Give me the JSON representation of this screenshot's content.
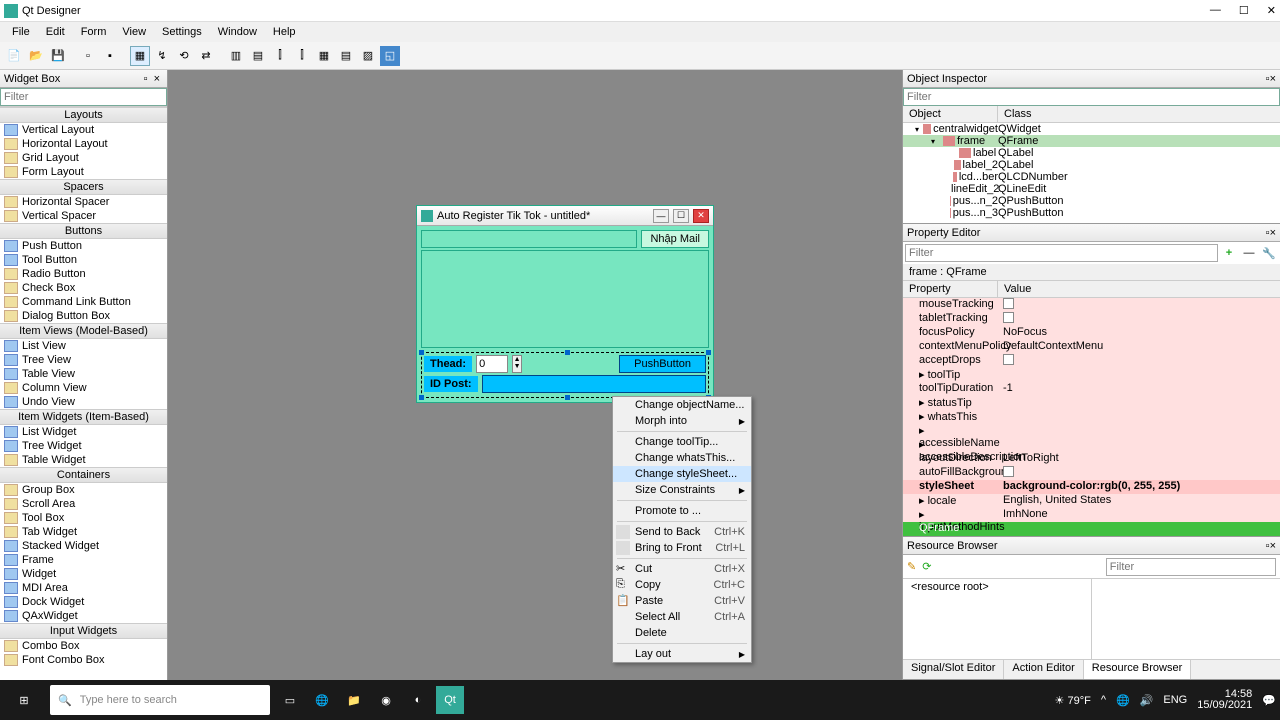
{
  "app": {
    "title": "Qt Designer"
  },
  "menus": [
    "File",
    "Edit",
    "Form",
    "View",
    "Settings",
    "Window",
    "Help"
  ],
  "widgetbox": {
    "title": "Widget Box",
    "filter_placeholder": "Filter",
    "groups": [
      {
        "header": "Layouts",
        "items": [
          "Vertical Layout",
          "Horizontal Layout",
          "Grid Layout",
          "Form Layout"
        ]
      },
      {
        "header": "Spacers",
        "items": [
          "Horizontal Spacer",
          "Vertical Spacer"
        ]
      },
      {
        "header": "Buttons",
        "items": [
          "Push Button",
          "Tool Button",
          "Radio Button",
          "Check Box",
          "Command Link Button",
          "Dialog Button Box"
        ]
      },
      {
        "header": "Item Views (Model-Based)",
        "items": [
          "List View",
          "Tree View",
          "Table View",
          "Column View",
          "Undo View"
        ]
      },
      {
        "header": "Item Widgets (Item-Based)",
        "items": [
          "List Widget",
          "Tree Widget",
          "Table Widget"
        ]
      },
      {
        "header": "Containers",
        "items": [
          "Group Box",
          "Scroll Area",
          "Tool Box",
          "Tab Widget",
          "Stacked Widget",
          "Frame",
          "Widget",
          "MDI Area",
          "Dock Widget",
          "QAxWidget"
        ]
      },
      {
        "header": "Input Widgets",
        "items": [
          "Combo Box",
          "Font Combo Box"
        ]
      }
    ]
  },
  "form": {
    "title": "Auto Register Tik Tok - untitled*",
    "nhapmail": "Nhập Mail",
    "thead_label": "Thead:",
    "thead_value": "0",
    "pushbutton": "PushButton",
    "idpost_label": "ID Post:"
  },
  "context_menu": {
    "change_objectname": "Change objectName...",
    "morph": "Morph into",
    "change_tooltip": "Change toolTip...",
    "change_whatsthis": "Change whatsThis...",
    "change_stylesheet": "Change styleSheet...",
    "size_constraints": "Size Constraints",
    "promote": "Promote to ...",
    "send_back": "Send to Back",
    "send_back_key": "Ctrl+K",
    "bring_front": "Bring to Front",
    "bring_front_key": "Ctrl+L",
    "cut": "Cut",
    "cut_key": "Ctrl+X",
    "copy": "Copy",
    "copy_key": "Ctrl+C",
    "paste": "Paste",
    "paste_key": "Ctrl+V",
    "select_all": "Select All",
    "select_all_key": "Ctrl+A",
    "delete": "Delete",
    "layout": "Lay out"
  },
  "object_inspector": {
    "title": "Object Inspector",
    "filter_placeholder": "Filter",
    "cols": {
      "object": "Object",
      "class": "Class"
    },
    "rows": [
      {
        "indent": 12,
        "name": "centralwidget",
        "cls": "QWidget",
        "exp": "▾"
      },
      {
        "indent": 28,
        "name": "frame",
        "cls": "QFrame",
        "exp": "▾",
        "sel": true
      },
      {
        "indent": 44,
        "name": "label",
        "cls": "QLabel"
      },
      {
        "indent": 44,
        "name": "label_2",
        "cls": "QLabel"
      },
      {
        "indent": 44,
        "name": "lcd...ber",
        "cls": "QLCDNumber"
      },
      {
        "indent": 44,
        "name": "lineEdit_2",
        "cls": "QLineEdit"
      },
      {
        "indent": 44,
        "name": "pus...n_2",
        "cls": "QPushButton"
      },
      {
        "indent": 44,
        "name": "pus...n_3",
        "cls": "QPushButton"
      }
    ]
  },
  "property_editor": {
    "title": "Property Editor",
    "filter_placeholder": "Filter",
    "context": "frame : QFrame",
    "cols": {
      "property": "Property",
      "value": "Value"
    },
    "rows": [
      {
        "cls": "pink",
        "name": "mouseTracking",
        "value_checkbox": true
      },
      {
        "cls": "pink",
        "name": "tabletTracking",
        "value_checkbox": true
      },
      {
        "cls": "pink",
        "name": "focusPolicy",
        "value": "NoFocus"
      },
      {
        "cls": "pink",
        "name": "contextMenuPolicy",
        "value": "DefaultContextMenu"
      },
      {
        "cls": "pink",
        "name": "acceptDrops",
        "value_checkbox": true
      },
      {
        "cls": "pink",
        "name": "toolTip",
        "value": "",
        "exp": true
      },
      {
        "cls": "pink",
        "name": "toolTipDuration",
        "value": "-1"
      },
      {
        "cls": "pink",
        "name": "statusTip",
        "value": "",
        "exp": true
      },
      {
        "cls": "pink",
        "name": "whatsThis",
        "value": "",
        "exp": true
      },
      {
        "cls": "pink",
        "name": "accessibleName",
        "value": "",
        "exp": true
      },
      {
        "cls": "pink",
        "name": "accessibleDescription",
        "value": "",
        "exp": true
      },
      {
        "cls": "pink",
        "name": "layoutDirection",
        "value": "LeftToRight"
      },
      {
        "cls": "pink",
        "name": "autoFillBackground",
        "value_checkbox": true
      },
      {
        "cls": "pink2",
        "name": "styleSheet",
        "value": "background-color:rgb(0, 255, 255)",
        "bold": true
      },
      {
        "cls": "pink",
        "name": "locale",
        "value": "English, United States",
        "exp": true
      },
      {
        "cls": "pink",
        "name": "inputMethodHints",
        "value": "ImhNone",
        "exp": true
      },
      {
        "cls": "green-sel",
        "name": "QFrame",
        "value": ""
      }
    ]
  },
  "resource_browser": {
    "title": "Resource Browser",
    "filter_placeholder": "Filter",
    "root": "<resource root>",
    "tabs": [
      "Signal/Slot Editor",
      "Action Editor",
      "Resource Browser"
    ]
  },
  "taskbar": {
    "search_placeholder": "Type here to search",
    "weather": "79°F",
    "lang": "ENG",
    "time": "14:58",
    "date": "15/09/2021"
  }
}
